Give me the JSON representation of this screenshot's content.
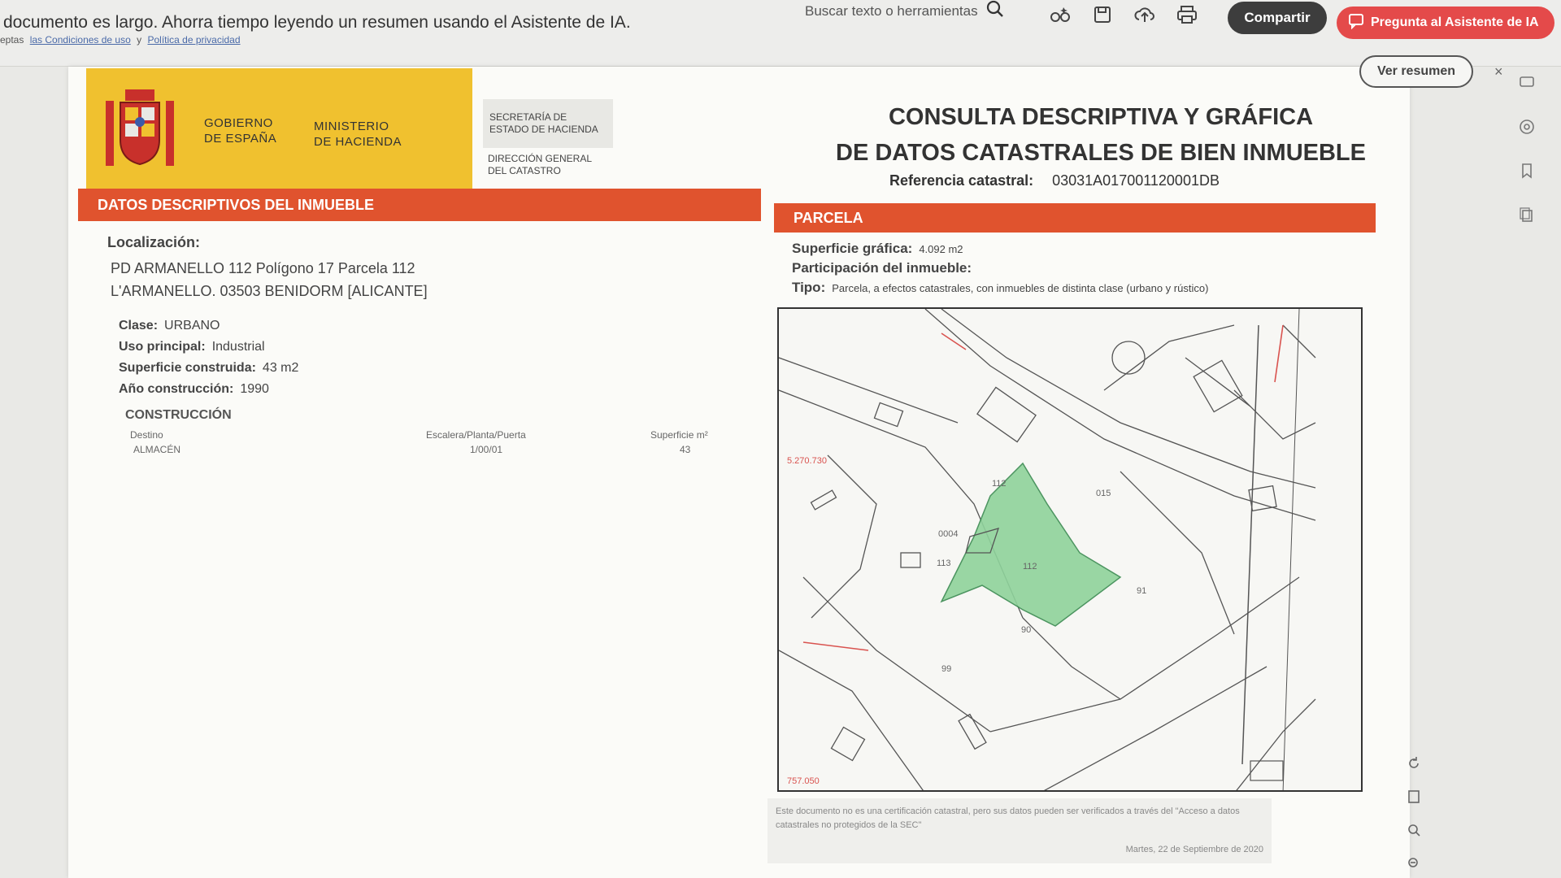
{
  "toolbar": {
    "banner": "documento es largo. Ahorra tiempo leyendo un resumen usando el Asistente de IA.",
    "links_prefix": "eptas",
    "terms_link": "las Condiciones de uso",
    "links_and": "y",
    "privacy_link": "Política de privacidad",
    "search_placeholder": "Buscar texto o herramientas",
    "share_label": "Compartir",
    "ask_ai_label": "Pregunta al Asistente de IA",
    "summary_label": "Ver resumen",
    "close_label": "×"
  },
  "header": {
    "gov_line1": "GOBIERNO",
    "gov_line2": "DE ESPAÑA",
    "ministry_line1": "MINISTERIO",
    "ministry_line2": "DE HACIENDA",
    "secretaria": "SECRETARÍA DE ESTADO DE HACIENDA",
    "direccion": "DIRECCIÓN GENERAL DEL CATASTRO",
    "title_line1": "CONSULTA DESCRIPTIVA Y GRÁFICA",
    "title_line2": "DE DATOS CATASTRALES DE BIEN INMUEBLE",
    "ref_label": "Referencia catastral:",
    "ref_value": "03031A017001120001DB"
  },
  "descriptive": {
    "section_title": "DATOS DESCRIPTIVOS DEL INMUEBLE",
    "location_label": "Localización:",
    "location_line1": "PD ARMANELLO 112 Polígono 17 Parcela 112",
    "location_line2": "L'ARMANELLO. 03503 BENIDORM [ALICANTE]",
    "clase_label": "Clase:",
    "clase_value": "URBANO",
    "uso_label": "Uso principal:",
    "uso_value": "Industrial",
    "superficie_label": "Superficie construida:",
    "superficie_value": "43 m2",
    "anio_label": "Año construcción:",
    "anio_value": "1990",
    "construccion_title": "CONSTRUCCIÓN",
    "table_headers": [
      "Destino",
      "Escalera/Planta/Puerta",
      "Superficie m²"
    ],
    "table_rows": [
      [
        "ALMACÉN",
        "1/00/01",
        "43"
      ]
    ]
  },
  "parcela": {
    "section_title": "PARCELA",
    "sup_label": "Superficie gráfica:",
    "sup_value": "4.092 m2",
    "part_label": "Participación del inmueble:",
    "tipo_label": "Tipo:",
    "tipo_value": "Parcela, a efectos catastrales, con inmuebles de distinta clase (urbano y rústico)"
  },
  "map": {
    "labels": [
      "112",
      "112",
      "015",
      "0004",
      "113",
      "99",
      "91",
      "90",
      "5.270.730",
      "757.050"
    ],
    "highlight_color": "#8fd39b",
    "line_color": "#555555",
    "red_color": "#d9534f"
  },
  "footer": {
    "disclaimer": "Este documento no es una certificación catastral, pero sus datos pueden ser verificados a través del \"Acceso a datos catastrales no protegidos de la SEC\"",
    "date": "Martes, 22 de Septiembre de 2020"
  },
  "colors": {
    "section_bar": "#e0532e",
    "logo_yellow": "#f0c12f",
    "share_button": "#3d3d3d",
    "ai_button": "#e44a4a"
  }
}
